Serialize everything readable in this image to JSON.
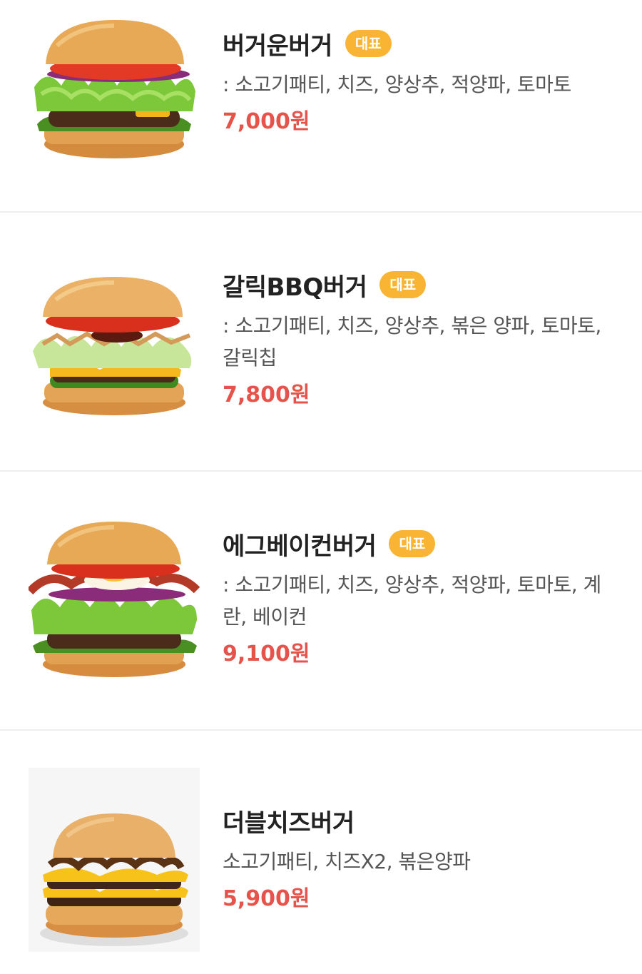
{
  "items": [
    {
      "name": "버거운버거",
      "badge": "대표",
      "desc": ": 소고기패티, 치즈, 양상추, 적양파, 토마토",
      "price": "7,000원",
      "image": "classic-burger-photo"
    },
    {
      "name": "갈릭BBQ버거",
      "badge": "대표",
      "desc": ": 소고기패티, 치즈, 양상추, 볶은 양파, 토마토, 갈릭칩",
      "price": "7,800원",
      "image": "garlic-bbq-burger-photo"
    },
    {
      "name": "에그베이컨버거",
      "badge": "대표",
      "desc": ": 소고기패티, 치즈, 양상추, 적양파, 토마토, 계란, 베이컨",
      "price": "9,100원",
      "image": "egg-bacon-burger-photo"
    },
    {
      "name": "더블치즈버거",
      "desc": "소고기패티, 치즈X2, 볶은양파",
      "price": "5,900원",
      "image": "double-cheese-burger-photo"
    }
  ],
  "colors": {
    "badge": "#f9b434",
    "price": "#e5534b",
    "divider": "#eeeeee"
  }
}
